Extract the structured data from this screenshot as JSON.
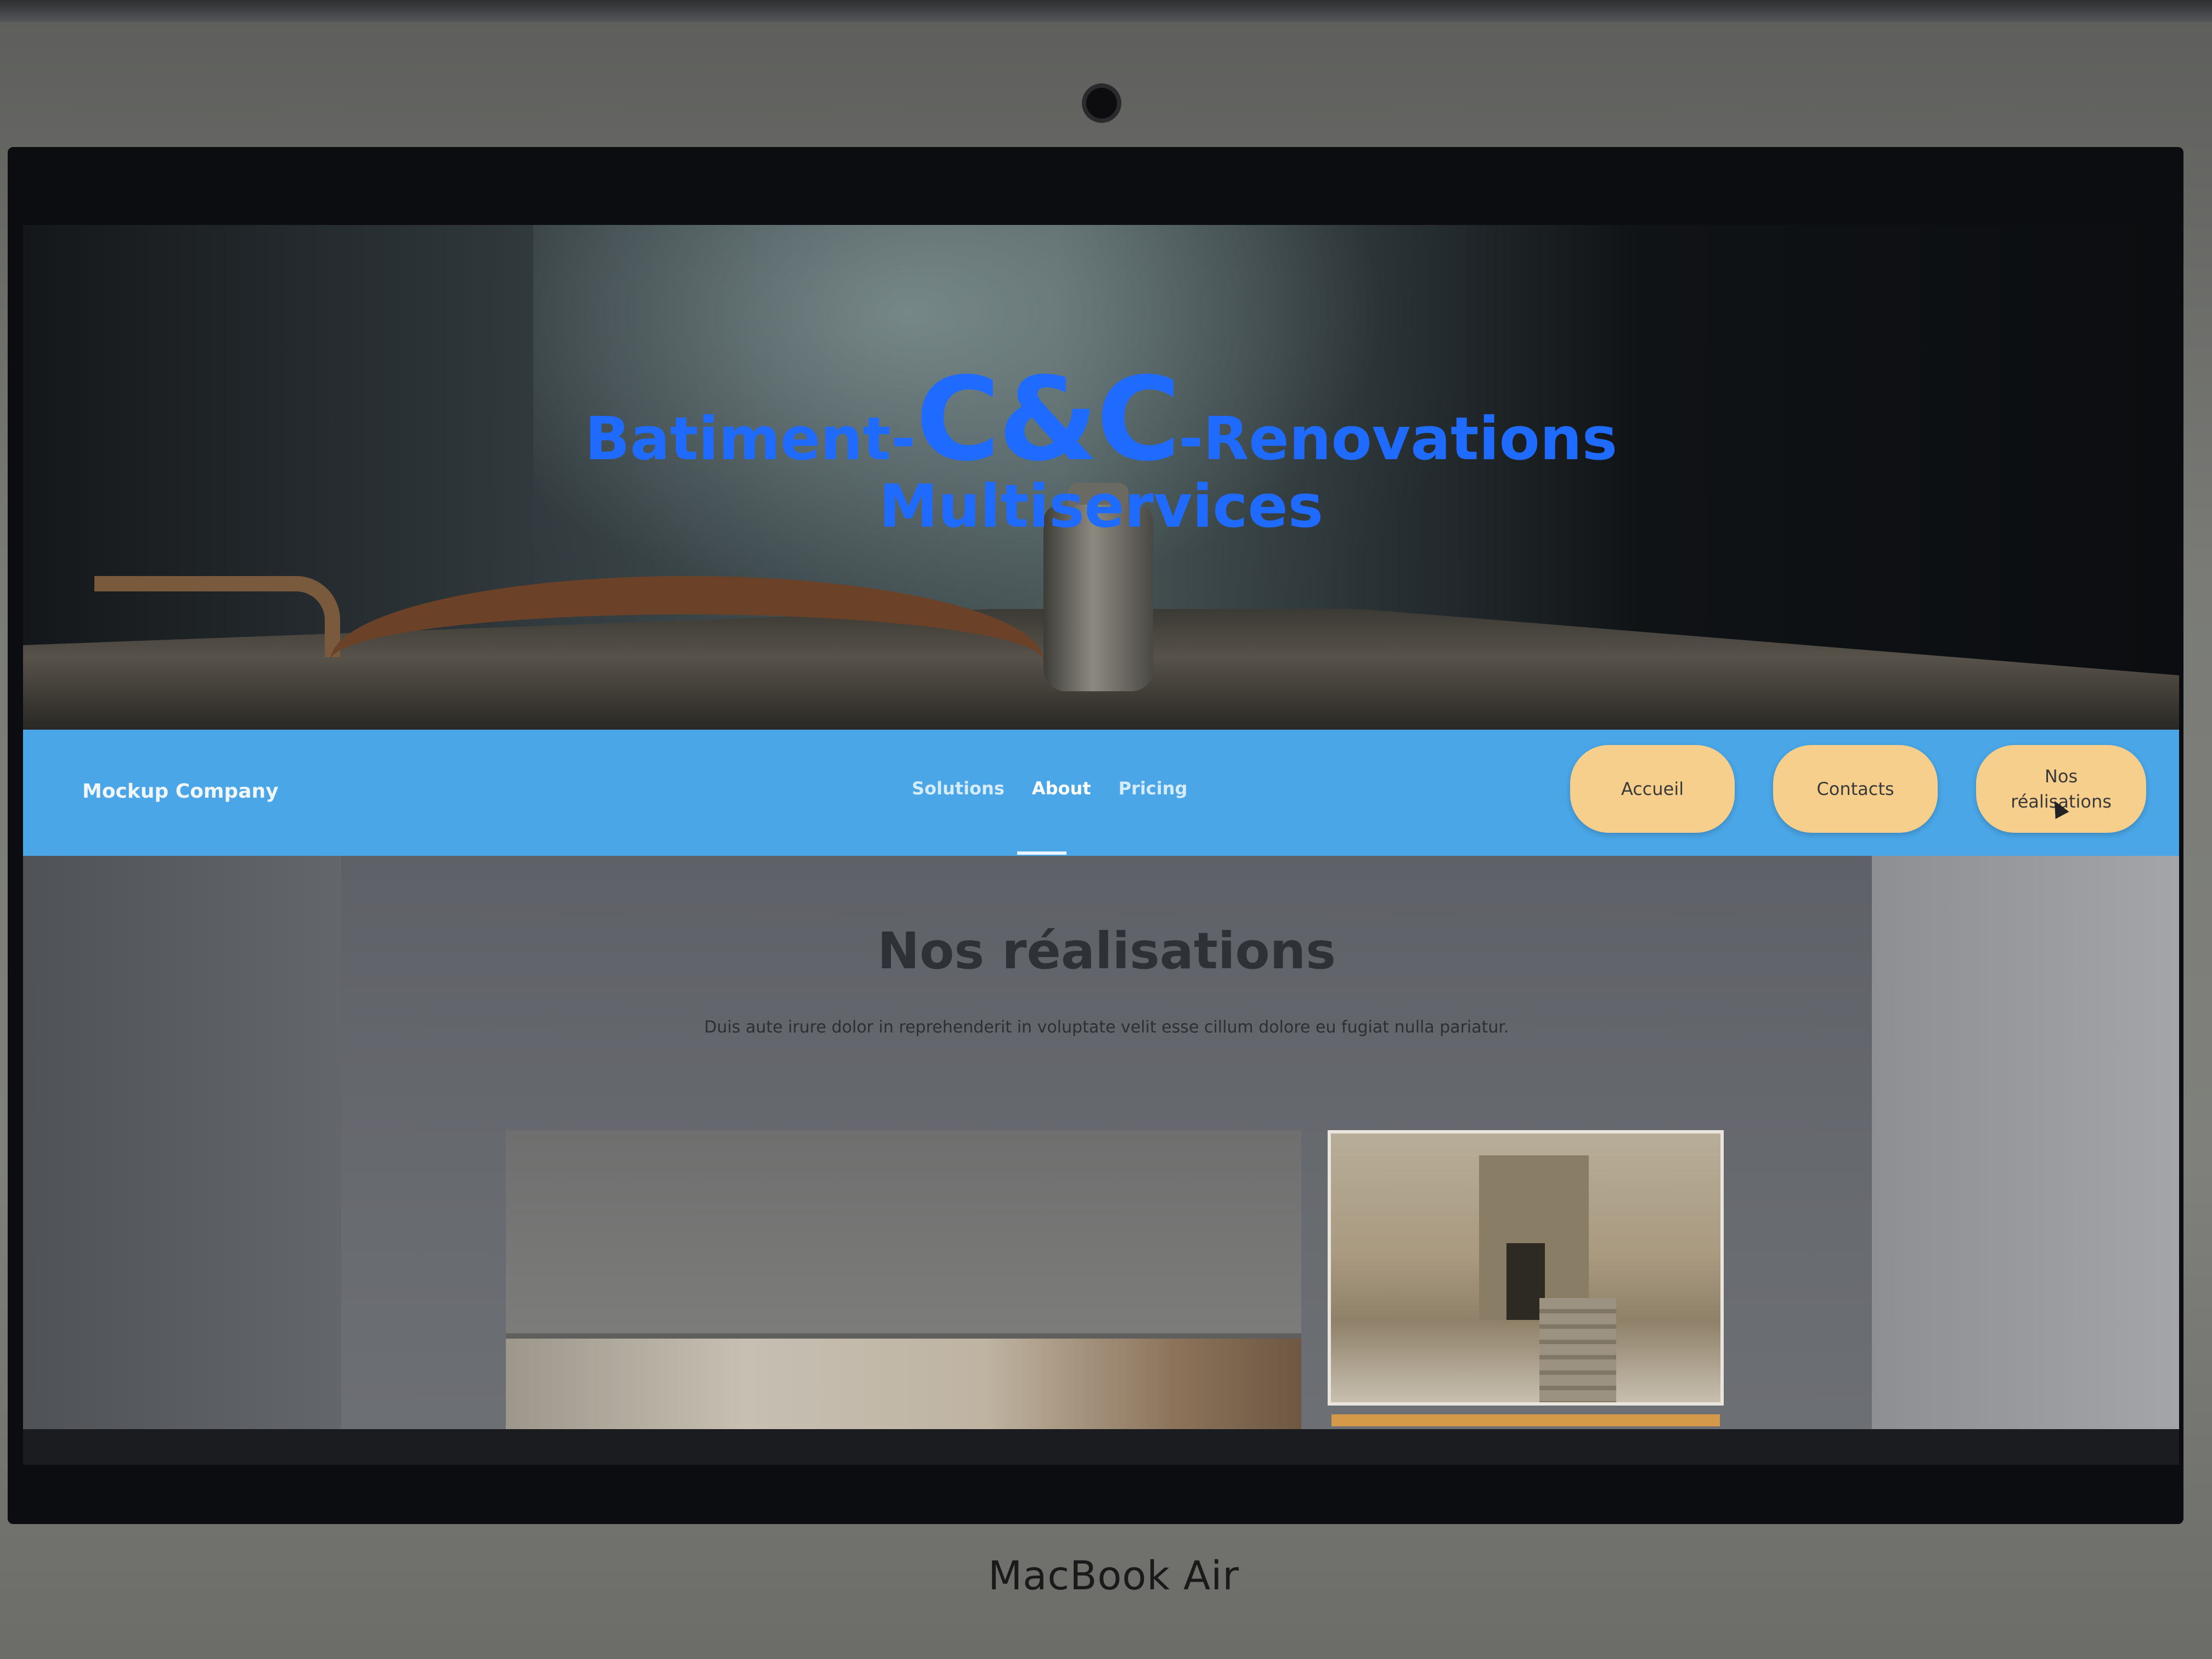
{
  "device": {
    "label": "MacBook Air"
  },
  "hero": {
    "title_prefix": "Batiment-",
    "title_main": "C&C",
    "title_suffix": "-Renovations",
    "subtitle": "Multiservices"
  },
  "nav": {
    "brand": "Mockup Company",
    "links": [
      {
        "label": "Solutions",
        "active": false
      },
      {
        "label": "About",
        "active": true
      },
      {
        "label": "Pricing",
        "active": false
      }
    ],
    "buttons": {
      "accueil": "Accueil",
      "contacts": "Contacts",
      "nos_realisations": "Nos réalisations"
    }
  },
  "section": {
    "title": "Nos réalisations",
    "text": "Duis aute irure dolor in reprehenderit in voluptate velit esse cillum dolore eu fugiat nulla pariatur."
  },
  "colors": {
    "nav_bar": "#4aa6e6",
    "hero_title": "#1f6bff",
    "pill_button": "#f7cf8c"
  }
}
